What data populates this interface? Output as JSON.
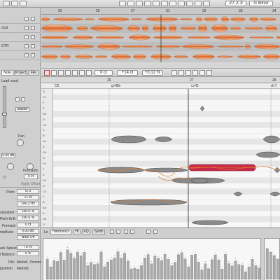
{
  "toolbar": {
    "position": "27.2.3",
    "key": "G Minor"
  },
  "ruler": {
    "bars": [
      "25",
      "26",
      "27",
      "31",
      "32",
      "33",
      "34",
      "35",
      "36"
    ]
  },
  "tracks": [
    {
      "name": "",
      "color": "#d9742d"
    },
    {
      "name": "ocal",
      "color": "#d9742d"
    },
    {
      "name": "",
      "color": "#d9742d"
    },
    {
      "name": "GTR",
      "color": "#d9742d"
    },
    {
      "name": "",
      "color": "#d9742d"
    }
  ],
  "left_panel": {
    "tabs": [
      "Note",
      "Project",
      "File"
    ],
    "instrument": "Lead vocal",
    "master_label": "Master",
    "pan_label": "Pan",
    "pan_value": "0.00 dB",
    "formants_label": "Formants",
    "formants_value": "0 ct",
    "tune_left": "0",
    "apply_offset": "Apply Offset",
    "pitch_label": "Pitch:",
    "pitch_value": "G 3",
    "cents_value": "+1 ct",
    "freq_value": "196.3 Hz",
    "modulation_label": "odulation:",
    "modulation_value": "100.0 %",
    "drift_label": "Pitch Drift:",
    "drift_value": "100.0 %",
    "formant_label": "Formant:",
    "formant_value": "0 ct",
    "amplitude_label": "mplitude:",
    "amplitude_value": "0.00 dB",
    "noteoff_value": "Note Off",
    "attack_label": "ack Speed:",
    "attack_value": "75 %",
    "balance_label": "l Balance:",
    "balance_value": "0 %",
    "file_label": "File:",
    "file_value": "MelodI...Domini",
    "algorithm_label": "lgorithm:",
    "algorithm_value": "Melodic"
  },
  "editor_toolbar": {
    "pitch_value": "0 ct",
    "offset_value": "+14 ct",
    "time_value": "+0.12 %"
  },
  "editor": {
    "bars": [
      "26",
      "27",
      "28"
    ],
    "chords": [
      "C5",
      "g>/Bb",
      "c>/G",
      "d>7"
    ],
    "key_labels": [
      "G",
      "F#",
      "F",
      "E",
      "D#",
      "D",
      "C#",
      "C",
      "B",
      "A#",
      "A",
      "G#",
      "G",
      "F#",
      "F",
      "E",
      "D#",
      "D",
      "C#",
      "C",
      "B",
      "A#",
      "A",
      "G#",
      "G"
    ],
    "highlight_color": "#c8284a"
  },
  "bottom": {
    "tabs": [
      "Harmonics",
      "Hi",
      "EQ",
      "Synth"
    ],
    "prefix": "Lo"
  }
}
